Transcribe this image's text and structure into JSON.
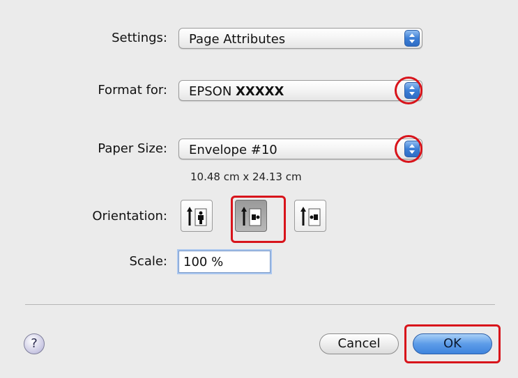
{
  "settings": {
    "label": "Settings:",
    "value": "Page Attributes"
  },
  "format_for": {
    "label": "Format for:",
    "value_prefix": "EPSON",
    "value_model": "XXXXX"
  },
  "paper_size": {
    "label": "Paper Size:",
    "value": "Envelope #10",
    "dimensions": "10.48 cm x 24.13 cm"
  },
  "orientation": {
    "label": "Orientation:",
    "options": [
      "portrait",
      "landscape-left",
      "landscape-right"
    ],
    "selected": "landscape-left"
  },
  "scale": {
    "label": "Scale:",
    "value": "100 %"
  },
  "buttons": {
    "help": "?",
    "cancel": "Cancel",
    "ok": "OK"
  },
  "colors": {
    "annotation": "#d8141b",
    "accent_blue": "#3d7fd6",
    "dialog_bg": "#ebebeb"
  }
}
